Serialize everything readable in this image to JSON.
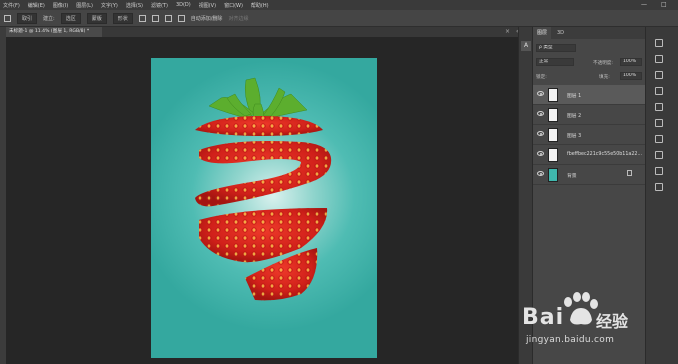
{
  "menubar": {
    "items": [
      "文件(F)",
      "编辑(E)",
      "图像(I)",
      "图层(L)",
      "文字(Y)",
      "选择(S)",
      "滤镜(T)",
      "3D(D)",
      "视图(V)",
      "窗口(W)",
      "帮助(H)"
    ],
    "window_controls": [
      "—",
      "□"
    ]
  },
  "options": {
    "tool_preset": "取引",
    "edge_label": "建立:",
    "select_subject": "选区",
    "mask": "蒙版",
    "shape": "形状",
    "auto_add": "自动添加/删除",
    "align_edges": "对齐边缘"
  },
  "document": {
    "tab_label": "未标题-1 @ 11.4% (图层 1, RGB/8) *",
    "close": "×",
    "collapse": "«"
  },
  "right_strip": {
    "panel_toggle": "A"
  },
  "layers_panel": {
    "tabs": [
      "图层",
      "3D"
    ],
    "filter_kind": "ρ 类型",
    "blend_mode": "正常",
    "opacity_label": "不透明度:",
    "opacity_value": "100%",
    "lock_label": "锁定:",
    "fill_label": "填充:",
    "fill_value": "100%",
    "layers": [
      {
        "name": "图层 1",
        "selected": true,
        "thumb": "strawberry-top"
      },
      {
        "name": "图层 2",
        "selected": false,
        "thumb": "strawberry-slice"
      },
      {
        "name": "图层 3",
        "selected": false,
        "thumb": "strawberry-slice"
      },
      {
        "name": "fbeffbec221c9c55e50b11a22...",
        "selected": false,
        "thumb": "strawberry-bottom"
      },
      {
        "name": "背景",
        "selected": false,
        "thumb": "teal-gradient",
        "locked": true
      }
    ]
  },
  "watermark": {
    "logo_text": "Bai",
    "logo_cn": "经验",
    "site": "jingyan.baidu.com"
  },
  "colors": {
    "canvas_bg": "#262626",
    "doc_teal": "#4fbcb3",
    "strawberry_red": "#d8261c",
    "leaf_green": "#5cae2e"
  }
}
